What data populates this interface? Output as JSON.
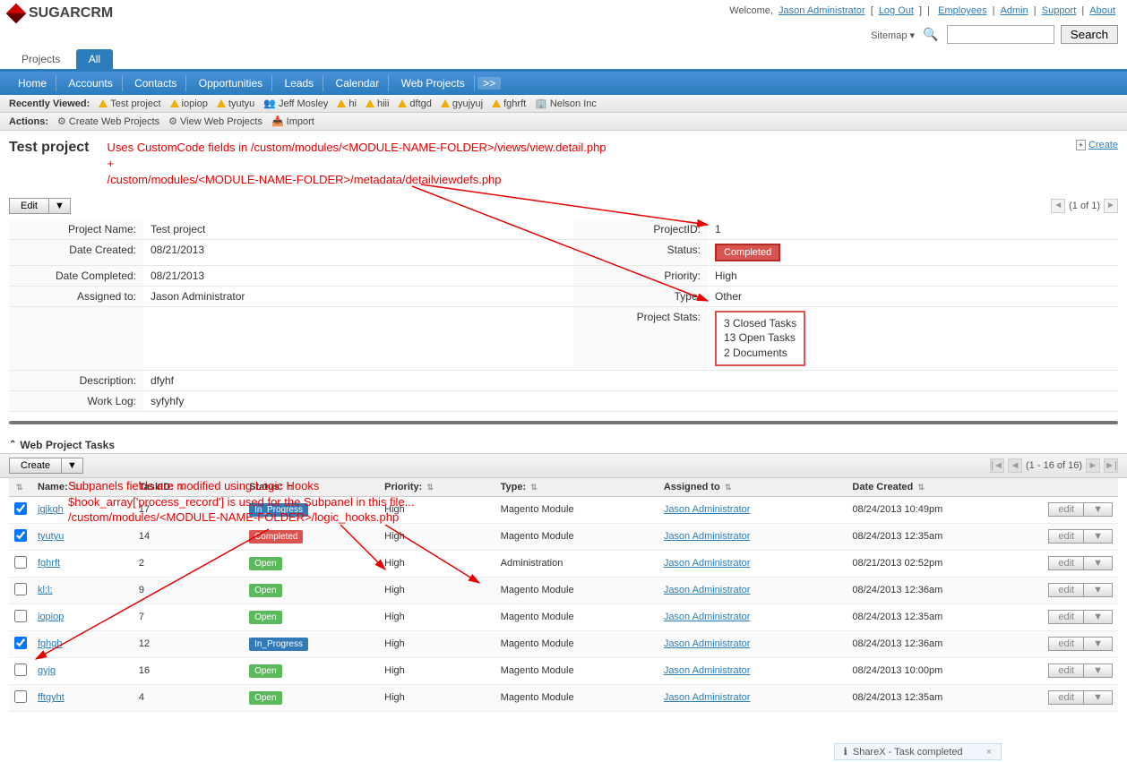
{
  "header": {
    "logo_text": "SUGARCRM",
    "welcome": "Welcome, ",
    "user_name": "Jason Administrator",
    "logout": "Log Out",
    "top_links": [
      "Employees",
      "Admin",
      "Support",
      "About"
    ],
    "sitemap": "Sitemap",
    "search_btn": "Search"
  },
  "modtabs": {
    "items": [
      "Projects",
      "All"
    ],
    "active_index": 1
  },
  "nav": {
    "items": [
      "Home",
      "Accounts",
      "Contacts",
      "Opportunities",
      "Leads",
      "Calendar",
      "Web Projects"
    ],
    "more": ">>"
  },
  "recent": {
    "label": "Recently Viewed:",
    "items": [
      "Test project",
      "iopiop",
      "tyutyu",
      "Jeff Mosley",
      "hi",
      "hiii",
      "dftgd",
      "gyujyuj",
      "fghrft",
      "Nelson Inc"
    ]
  },
  "actions": {
    "label": "Actions:",
    "items": [
      "Create Web Projects",
      "View Web Projects",
      "Import"
    ]
  },
  "title": "Test project",
  "annotation_top_l1": "Uses CustomCode fields in /custom/modules/<MODULE-NAME-FOLDER>/views/view.detail.php",
  "annotation_top_plus": "+",
  "annotation_top_l2": "/custom/modules/<MODULE-NAME-FOLDER>/metadata/detailviewdefs.php",
  "create_link": "Create",
  "edit_btn": "Edit",
  "pager_detail": "(1 of 1)",
  "detail": {
    "project_name_label": "Project Name:",
    "project_name": "Test project",
    "project_id_label": "ProjectID:",
    "project_id": "1",
    "date_created_label": "Date Created:",
    "date_created": "08/21/2013",
    "status_label": "Status:",
    "status": "Completed",
    "date_completed_label": "Date Completed:",
    "date_completed": "08/21/2013",
    "priority_label": "Priority:",
    "priority": "High",
    "assigned_label": "Assigned to:",
    "assigned": "Jason Administrator",
    "type_label": "Type:",
    "type": "Other",
    "stats_label": "Project Stats:",
    "stats_l1": " 3 Closed Tasks",
    "stats_l2": "13 Open Tasks",
    "stats_l3": " 2 Documents",
    "desc_label": "Description:",
    "desc": "dfyhf",
    "worklog_label": "Work Log:",
    "worklog": "syfyhfy"
  },
  "subpanel_title": "Web Project Tasks",
  "create_btn": "Create",
  "pager_sub": "(1 - 16 of 16)",
  "annotation_sub_l1": "Subpanels fields are modified using Logic Hooks",
  "annotation_sub_l2": "$hook_array['process_record'] is used for the Subpanel in this file...",
  "annotation_sub_l3": "/custom/modules/<MODULE-NAME-FOLDER>/logic_hooks.php",
  "cols": {
    "name": "Name:",
    "taskid": "TaskID:",
    "status": "Status:",
    "priority": "Priority:",
    "type": "Type:",
    "assigned": "Assigned to",
    "created": "Date Created"
  },
  "rows": [
    {
      "chk": true,
      "name": "jgjkgh",
      "taskid": "17",
      "status": "In_Progress",
      "priority": "High",
      "type": "Magento Module",
      "assigned": "Jason Administrator",
      "created": "08/24/2013 10:49pm",
      "edit": "edit"
    },
    {
      "chk": true,
      "name": "tyutyu",
      "taskid": "14",
      "status": "Completed",
      "priority": "High",
      "type": "Magento Module",
      "assigned": "Jason Administrator",
      "created": "08/24/2013 12:35am",
      "edit": "edit"
    },
    {
      "chk": false,
      "name": "fghrft",
      "taskid": "2",
      "status": "Open",
      "priority": "High",
      "type": "Administration",
      "assigned": "Jason Administrator",
      "created": "08/21/2013 02:52pm",
      "edit": "edit"
    },
    {
      "chk": false,
      "name": "kl;l;",
      "taskid": "9",
      "status": "Open",
      "priority": "High",
      "type": "Magento Module",
      "assigned": "Jason Administrator",
      "created": "08/24/2013 12:36am",
      "edit": "edit"
    },
    {
      "chk": false,
      "name": "iopiop",
      "taskid": "7",
      "status": "Open",
      "priority": "High",
      "type": "Magento Module",
      "assigned": "Jason Administrator",
      "created": "08/24/2013 12:35am",
      "edit": "edit"
    },
    {
      "chk": true,
      "name": "fghgh",
      "taskid": "12",
      "status": "In_Progress",
      "priority": "High",
      "type": "Magento Module",
      "assigned": "Jason Administrator",
      "created": "08/24/2013 12:36am",
      "edit": "edit"
    },
    {
      "chk": false,
      "name": "gyjg",
      "taskid": "16",
      "status": "Open",
      "priority": "High",
      "type": "Magento Module",
      "assigned": "Jason Administrator",
      "created": "08/24/2013 10:00pm",
      "edit": "edit"
    },
    {
      "chk": false,
      "name": "fftgyht",
      "taskid": "4",
      "status": "Open",
      "priority": "High",
      "type": "Magento Module",
      "assigned": "Jason Administrator",
      "created": "08/24/2013 12:35am",
      "edit": "edit"
    }
  ],
  "toast": {
    "text": "ShareX - Task completed",
    "info_icon": "ℹ"
  }
}
